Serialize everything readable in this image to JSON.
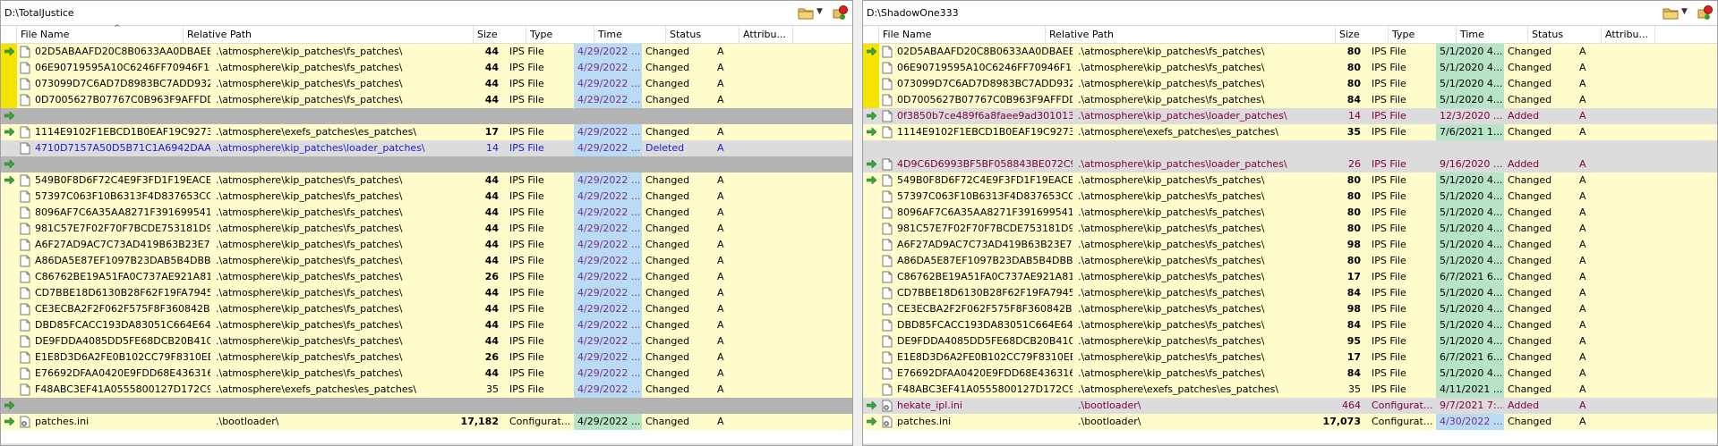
{
  "left": {
    "path": "D:\\TotalJustice",
    "columns": {
      "name": "File Name",
      "path": "Relative Path",
      "size": "Size",
      "type": "Type",
      "time": "Time",
      "status": "Status",
      "attr": "Attribu..."
    },
    "rows": [
      {
        "kind": "changed",
        "arrow": true,
        "yellow": true,
        "name": "02D5ABAAFD20C8B0633AA0DBAEE0...",
        "path": ".\\atmosphere\\kip_patches\\fs_patches\\",
        "size": "44",
        "type": "IPS File",
        "time": "4/29/2022 ...",
        "tc": "blue",
        "status": "Changed",
        "attr": "A"
      },
      {
        "kind": "changed",
        "arrow": false,
        "yellow": true,
        "name": "06E90719595A10C6246FF70946F10F...",
        "path": ".\\atmosphere\\kip_patches\\fs_patches\\",
        "size": "44",
        "type": "IPS File",
        "time": "4/29/2022 ...",
        "tc": "blue",
        "status": "Changed",
        "attr": "A"
      },
      {
        "kind": "changed",
        "arrow": false,
        "yellow": true,
        "name": "073099D7C6AD7D8983BC7ADD932BE...",
        "path": ".\\atmosphere\\kip_patches\\fs_patches\\",
        "size": "44",
        "type": "IPS File",
        "time": "4/29/2022 ...",
        "tc": "blue",
        "status": "Changed",
        "attr": "A"
      },
      {
        "kind": "changed",
        "arrow": false,
        "yellow": true,
        "name": "0D7005627B07767C0B963F9AFFDDE5...",
        "path": ".\\atmosphere\\kip_patches\\fs_patches\\",
        "size": "44",
        "type": "IPS File",
        "time": "4/29/2022 ...",
        "tc": "blue",
        "status": "Changed",
        "attr": "A"
      },
      {
        "kind": "gap",
        "arrow": true
      },
      {
        "kind": "changed",
        "arrow": true,
        "name": "1114E9102F1EBCD1B0EAF19C927362...",
        "path": ".\\atmosphere\\exefs_patches\\es_patches\\",
        "size": "17",
        "type": "IPS File",
        "time": "4/29/2022 ...",
        "tc": "blue",
        "status": "Changed",
        "attr": "A"
      },
      {
        "kind": "deleted",
        "arrow": false,
        "name": "4710D7157A50D5B71C1A6942DAA82...",
        "path": ".\\atmosphere\\kip_patches\\loader_patches\\",
        "size": "14",
        "sizenorm": true,
        "type": "IPS File",
        "time": "4/29/2022 ...",
        "tc": "blue",
        "status": "Deleted",
        "attr": "A"
      },
      {
        "kind": "gap",
        "arrow": true
      },
      {
        "kind": "changed",
        "arrow": true,
        "name": "549B0F8D6F72C4E9F3FD1F19EACE4A...",
        "path": ".\\atmosphere\\kip_patches\\fs_patches\\",
        "size": "44",
        "type": "IPS File",
        "time": "4/29/2022 ...",
        "tc": "blue",
        "status": "Changed",
        "attr": "A"
      },
      {
        "kind": "changed",
        "name": "57397C063F10B6313F4D837653CCC3...",
        "path": ".\\atmosphere\\kip_patches\\fs_patches\\",
        "size": "44",
        "type": "IPS File",
        "time": "4/29/2022 ...",
        "tc": "blue",
        "status": "Changed",
        "attr": "A"
      },
      {
        "kind": "changed",
        "name": "8096AF7C6A35AA8271F3916995413B...",
        "path": ".\\atmosphere\\kip_patches\\fs_patches\\",
        "size": "44",
        "type": "IPS File",
        "time": "4/29/2022 ...",
        "tc": "blue",
        "status": "Changed",
        "attr": "A"
      },
      {
        "kind": "changed",
        "name": "981C57E7F02F70F7BCDE753181D901...",
        "path": ".\\atmosphere\\kip_patches\\fs_patches\\",
        "size": "44",
        "type": "IPS File",
        "time": "4/29/2022 ...",
        "tc": "blue",
        "status": "Changed",
        "attr": "A"
      },
      {
        "kind": "changed",
        "name": "A6F27AD9AC7C73AD419B63B23E785...",
        "path": ".\\atmosphere\\kip_patches\\fs_patches\\",
        "size": "44",
        "type": "IPS File",
        "time": "4/29/2022 ...",
        "tc": "blue",
        "status": "Changed",
        "attr": "A"
      },
      {
        "kind": "changed",
        "name": "A86DA5E87EF1097B23DAB5B4DBBAE...",
        "path": ".\\atmosphere\\kip_patches\\fs_patches\\",
        "size": "44",
        "type": "IPS File",
        "time": "4/29/2022 ...",
        "tc": "blue",
        "status": "Changed",
        "attr": "A"
      },
      {
        "kind": "changed",
        "name": "C86762BE19A51FA0C737AE921A8168...",
        "path": ".\\atmosphere\\kip_patches\\fs_patches\\",
        "size": "26",
        "type": "IPS File",
        "time": "4/29/2022 ...",
        "tc": "blue",
        "status": "Changed",
        "attr": "A"
      },
      {
        "kind": "changed",
        "name": "CD7BBE18D6130B28F62F19FA794553...",
        "path": ".\\atmosphere\\kip_patches\\fs_patches\\",
        "size": "44",
        "type": "IPS File",
        "time": "4/29/2022 ...",
        "tc": "blue",
        "status": "Changed",
        "attr": "A"
      },
      {
        "kind": "changed",
        "name": "CE3ECBA2F2F062F575F8F360842B32B...",
        "path": ".\\atmosphere\\kip_patches\\fs_patches\\",
        "size": "44",
        "type": "IPS File",
        "time": "4/29/2022 ...",
        "tc": "blue",
        "status": "Changed",
        "attr": "A"
      },
      {
        "kind": "changed",
        "name": "DBD85FCACC193DA83051C664E6452...",
        "path": ".\\atmosphere\\kip_patches\\fs_patches\\",
        "size": "44",
        "type": "IPS File",
        "time": "4/29/2022 ...",
        "tc": "blue",
        "status": "Changed",
        "attr": "A"
      },
      {
        "kind": "changed",
        "name": "DE9FDDA4085DD5FE68DCB20B41095...",
        "path": ".\\atmosphere\\kip_patches\\fs_patches\\",
        "size": "44",
        "type": "IPS File",
        "time": "4/29/2022 ...",
        "tc": "blue",
        "status": "Changed",
        "attr": "A"
      },
      {
        "kind": "changed",
        "name": "E1E8D3D6A2FE0B102CC79F8310EEEF...",
        "path": ".\\atmosphere\\kip_patches\\fs_patches\\",
        "size": "26",
        "type": "IPS File",
        "time": "4/29/2022 ...",
        "tc": "blue",
        "status": "Changed",
        "attr": "A"
      },
      {
        "kind": "changed",
        "name": "E76692DFAA0420E9FDD68E436316181...",
        "path": ".\\atmosphere\\kip_patches\\fs_patches\\",
        "size": "44",
        "type": "IPS File",
        "time": "4/29/2022 ...",
        "tc": "blue",
        "status": "Changed",
        "attr": "A"
      },
      {
        "kind": "changed",
        "name": "F48ABC3EF41A0555800127D172C9B8...",
        "path": ".\\atmosphere\\exefs_patches\\es_patches\\",
        "size": "35",
        "sizenorm": true,
        "type": "IPS File",
        "time": "4/29/2022 ...",
        "tc": "blue",
        "status": "Changed",
        "attr": "A"
      },
      {
        "kind": "gap",
        "arrow": true
      },
      {
        "kind": "changed",
        "arrow": true,
        "ini": true,
        "name": "patches.ini",
        "path": ".\\bootloader\\",
        "size": "17,182",
        "type": "Configurat...",
        "time": "4/29/2022 ...",
        "tc": "green",
        "status": "Changed",
        "attr": "A"
      }
    ]
  },
  "right": {
    "path": "D:\\ShadowOne333",
    "columns": {
      "name": "File Name",
      "path": "Relative Path",
      "size": "Size",
      "type": "Type",
      "time": "Time",
      "status": "Status",
      "attr": "Attribu..."
    },
    "rows": [
      {
        "kind": "changed",
        "arrow": true,
        "yellow": true,
        "name": "02D5ABAAFD20C8B0633AA0DBAEE0...",
        "path": ".\\atmosphere\\kip_patches\\fs_patches\\",
        "size": "80",
        "type": "IPS File",
        "time": "5/1/2020 4...",
        "tc": "green",
        "status": "Changed",
        "attr": "A"
      },
      {
        "kind": "changed",
        "arrow": false,
        "yellow": true,
        "name": "06E90719595A10C6246FF70946F10F...",
        "path": ".\\atmosphere\\kip_patches\\fs_patches\\",
        "size": "80",
        "type": "IPS File",
        "time": "5/1/2020 4...",
        "tc": "green",
        "status": "Changed",
        "attr": "A"
      },
      {
        "kind": "changed",
        "arrow": false,
        "yellow": true,
        "name": "073099D7C6AD7D8983BC7ADD932BE...",
        "path": ".\\atmosphere\\kip_patches\\fs_patches\\",
        "size": "80",
        "type": "IPS File",
        "time": "5/1/2020 4...",
        "tc": "green",
        "status": "Changed",
        "attr": "A"
      },
      {
        "kind": "changed",
        "arrow": false,
        "yellow": true,
        "name": "0D7005627B07767C0B963F9AFFDDE5...",
        "path": ".\\atmosphere\\kip_patches\\fs_patches\\",
        "size": "84",
        "type": "IPS File",
        "time": "5/1/2020 4...",
        "tc": "green",
        "status": "Changed",
        "attr": "A"
      },
      {
        "kind": "added",
        "arrow": true,
        "name": "0f3850b7ce489f6a8faee9ad301013f66...",
        "path": ".\\atmosphere\\kip_patches\\loader_patches\\",
        "size": "14",
        "sizenorm": true,
        "type": "IPS File",
        "time": "12/3/2020 ...",
        "tc": "none",
        "status": "Added",
        "attr": "A"
      },
      {
        "kind": "changed",
        "arrow": true,
        "name": "1114E9102F1EBCD1B0EAF19C927362...",
        "path": ".\\atmosphere\\exefs_patches\\es_patches\\",
        "size": "35",
        "type": "IPS File",
        "time": "7/6/2021 1...",
        "tc": "green",
        "status": "Changed",
        "attr": "A"
      },
      {
        "kind": "gap",
        "arrow": false,
        "light": true
      },
      {
        "kind": "added",
        "arrow": true,
        "name": "4D9C6D6993BF5BF058843BE072C981...",
        "path": ".\\atmosphere\\kip_patches\\loader_patches\\",
        "size": "26",
        "sizenorm": true,
        "type": "IPS File",
        "time": "9/16/2020 ...",
        "tc": "none",
        "status": "Added",
        "attr": "A"
      },
      {
        "kind": "changed",
        "arrow": true,
        "name": "549B0F8D6F72C4E9F3FD1F19EACE4A...",
        "path": ".\\atmosphere\\kip_patches\\fs_patches\\",
        "size": "80",
        "type": "IPS File",
        "time": "5/1/2020 4...",
        "tc": "green",
        "status": "Changed",
        "attr": "A"
      },
      {
        "kind": "changed",
        "name": "57397C063F10B6313F4D837653CCC3...",
        "path": ".\\atmosphere\\kip_patches\\fs_patches\\",
        "size": "80",
        "type": "IPS File",
        "time": "5/1/2020 4...",
        "tc": "green",
        "status": "Changed",
        "attr": "A"
      },
      {
        "kind": "changed",
        "name": "8096AF7C6A35AA8271F3916995413B...",
        "path": ".\\atmosphere\\kip_patches\\fs_patches\\",
        "size": "80",
        "type": "IPS File",
        "time": "5/1/2020 4...",
        "tc": "green",
        "status": "Changed",
        "attr": "A"
      },
      {
        "kind": "changed",
        "name": "981C57E7F02F70F7BCDE753181D901...",
        "path": ".\\atmosphere\\kip_patches\\fs_patches\\",
        "size": "80",
        "type": "IPS File",
        "time": "5/1/2020 4...",
        "tc": "green",
        "status": "Changed",
        "attr": "A"
      },
      {
        "kind": "changed",
        "name": "A6F27AD9AC7C73AD419B63B23E785...",
        "path": ".\\atmosphere\\kip_patches\\fs_patches\\",
        "size": "98",
        "type": "IPS File",
        "time": "5/1/2020 4...",
        "tc": "green",
        "status": "Changed",
        "attr": "A"
      },
      {
        "kind": "changed",
        "name": "A86DA5E87EF1097B23DAB5B4DBBAE...",
        "path": ".\\atmosphere\\kip_patches\\fs_patches\\",
        "size": "80",
        "type": "IPS File",
        "time": "5/1/2020 4...",
        "tc": "green",
        "status": "Changed",
        "attr": "A"
      },
      {
        "kind": "changed",
        "name": "C86762BE19A51FA0C737AE921A8168...",
        "path": ".\\atmosphere\\kip_patches\\fs_patches\\",
        "size": "17",
        "type": "IPS File",
        "time": "6/7/2021 6...",
        "tc": "green",
        "status": "Changed",
        "attr": "A"
      },
      {
        "kind": "changed",
        "name": "CD7BBE18D6130B28F62F19FA794553...",
        "path": ".\\atmosphere\\kip_patches\\fs_patches\\",
        "size": "84",
        "type": "IPS File",
        "time": "5/1/2020 4...",
        "tc": "green",
        "status": "Changed",
        "attr": "A"
      },
      {
        "kind": "changed",
        "name": "CE3ECBA2F2F062F575F8F360842B32B...",
        "path": ".\\atmosphere\\kip_patches\\fs_patches\\",
        "size": "98",
        "type": "IPS File",
        "time": "5/1/2020 4...",
        "tc": "green",
        "status": "Changed",
        "attr": "A"
      },
      {
        "kind": "changed",
        "name": "DBD85FCACC193DA83051C664E6452...",
        "path": ".\\atmosphere\\kip_patches\\fs_patches\\",
        "size": "84",
        "type": "IPS File",
        "time": "5/1/2020 4...",
        "tc": "green",
        "status": "Changed",
        "attr": "A"
      },
      {
        "kind": "changed",
        "name": "DE9FDDA4085DD5FE68DCB20B41095...",
        "path": ".\\atmosphere\\kip_patches\\fs_patches\\",
        "size": "95",
        "type": "IPS File",
        "time": "5/1/2020 4...",
        "tc": "green",
        "status": "Changed",
        "attr": "A"
      },
      {
        "kind": "changed",
        "name": "E1E8D3D6A2FE0B102CC79F8310EEEF...",
        "path": ".\\atmosphere\\kip_patches\\fs_patches\\",
        "size": "17",
        "type": "IPS File",
        "time": "6/7/2021 6...",
        "tc": "green",
        "status": "Changed",
        "attr": "A"
      },
      {
        "kind": "changed",
        "name": "E76692DFAA0420E9FDD68E436316181...",
        "path": ".\\atmosphere\\kip_patches\\fs_patches\\",
        "size": "84",
        "type": "IPS File",
        "time": "5/1/2020 4...",
        "tc": "green",
        "status": "Changed",
        "attr": "A"
      },
      {
        "kind": "changed",
        "name": "F48ABC3EF41A0555800127D172C9B8...",
        "path": ".\\atmosphere\\exefs_patches\\es_patches\\",
        "size": "35",
        "sizenorm": true,
        "type": "IPS File",
        "time": "4/11/2021 ...",
        "tc": "green",
        "status": "Changed",
        "attr": "A"
      },
      {
        "kind": "added",
        "arrow": true,
        "ini": true,
        "name": "hekate_ipl.ini",
        "path": ".\\bootloader\\",
        "size": "464",
        "sizenorm": true,
        "type": "Configurat...",
        "time": "9/7/2021 7:...",
        "tc": "none",
        "status": "Added",
        "attr": "A"
      },
      {
        "kind": "changed",
        "arrow": true,
        "ini": true,
        "name": "patches.ini",
        "path": ".\\bootloader\\",
        "size": "17,073",
        "type": "Configurat...",
        "time": "4/30/2022 ...",
        "tc": "blue",
        "status": "Changed",
        "attr": "A"
      }
    ]
  },
  "colors": {
    "changed": "#fefdcb",
    "gap": "#b4b4b4",
    "strip": "#f5e400",
    "arrow": "#3aa83a",
    "time_blue": "#b9dbf4",
    "time_green": "#b7e3c7"
  },
  "icons": {
    "arrow": "arrow-right-icon",
    "file": "file-icon",
    "ini": "ini-file-icon",
    "folder": "folder-icon",
    "sync": "sync-icon",
    "dropdown": "chevron-down-icon"
  }
}
